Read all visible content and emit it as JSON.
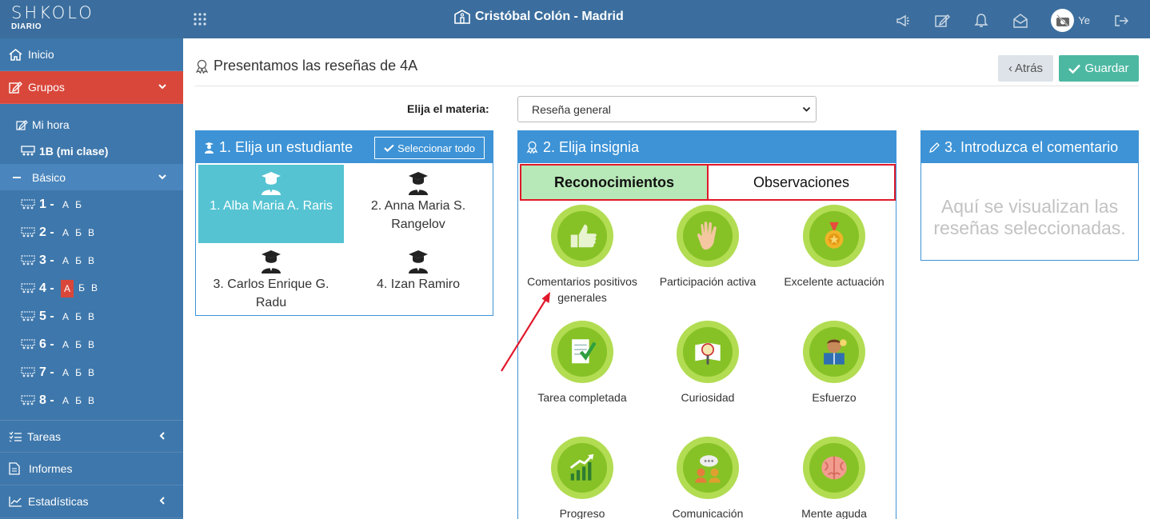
{
  "header": {
    "logo_name": "SHKOLO",
    "logo_sub": "DIARIO",
    "school": "Cristóbal Colón - Madrid",
    "user_short": "Ye"
  },
  "sidebar": {
    "inicio": "Inicio",
    "grupos": "Grupos",
    "mi_hora": "Mi hora",
    "mi_clase": "1B (mi clase)",
    "basico": "Básico",
    "grades": [
      {
        "num": "1 -",
        "letters": [
          "А",
          "Б"
        ]
      },
      {
        "num": "2 -",
        "letters": [
          "А",
          "Б",
          "В"
        ]
      },
      {
        "num": "3 -",
        "letters": [
          "А",
          "Б",
          "В"
        ]
      },
      {
        "num": "4 -",
        "letters": [
          "А",
          "Б",
          "В"
        ],
        "selected": "А"
      },
      {
        "num": "5 -",
        "letters": [
          "А",
          "Б",
          "В"
        ]
      },
      {
        "num": "6 -",
        "letters": [
          "А",
          "Б",
          "В"
        ]
      },
      {
        "num": "7 -",
        "letters": [
          "А",
          "Б",
          "В"
        ]
      },
      {
        "num": "8 -",
        "letters": [
          "А",
          "Б",
          "В"
        ]
      }
    ],
    "tareas": "Tareas",
    "informes": "Informes",
    "estadisticas": "Estadísticas"
  },
  "page": {
    "title": "Presentamos las reseñas de 4A",
    "back_label": "Atrás",
    "save_label": "Guardar",
    "subject_label": "Elija el materia:",
    "subject_value": "Reseña general"
  },
  "panel1": {
    "title": "1. Elija un estudiante",
    "select_all": "Seleccionar todo",
    "students": [
      {
        "name": "1. Alba Maria A. Raris",
        "selected": true
      },
      {
        "name": "2. Anna Maria S. Rangelov",
        "selected": false
      },
      {
        "name": "3. Carlos Enrique G. Radu",
        "selected": false
      },
      {
        "name": "4. Izan Ramiro",
        "selected": false
      }
    ]
  },
  "panel2": {
    "title": "2. Elija insignia",
    "tab_active": "Reconocimientos",
    "tab_inactive": "Observaciones",
    "badges": [
      {
        "label": "Comentarios positivos generales",
        "icon": "thumbs-up-icon"
      },
      {
        "label": "Participación activa",
        "icon": "raised-hand-icon"
      },
      {
        "label": "Excelente actuación",
        "icon": "medal-icon"
      },
      {
        "label": "Tarea completada",
        "icon": "checked-notebook-icon"
      },
      {
        "label": "Curiosidad",
        "icon": "magnifier-book-icon"
      },
      {
        "label": "Esfuerzo",
        "icon": "reading-kid-icon"
      },
      {
        "label": "Progreso",
        "icon": "growth-chart-icon"
      },
      {
        "label": "Comunicación",
        "icon": "speech-people-icon"
      },
      {
        "label": "Mente aguda",
        "icon": "brain-icon"
      }
    ]
  },
  "panel3": {
    "title": "3. Introduzca el comentario",
    "placeholder": "Aquí se visualizan las reseñas seleccionadas."
  }
}
